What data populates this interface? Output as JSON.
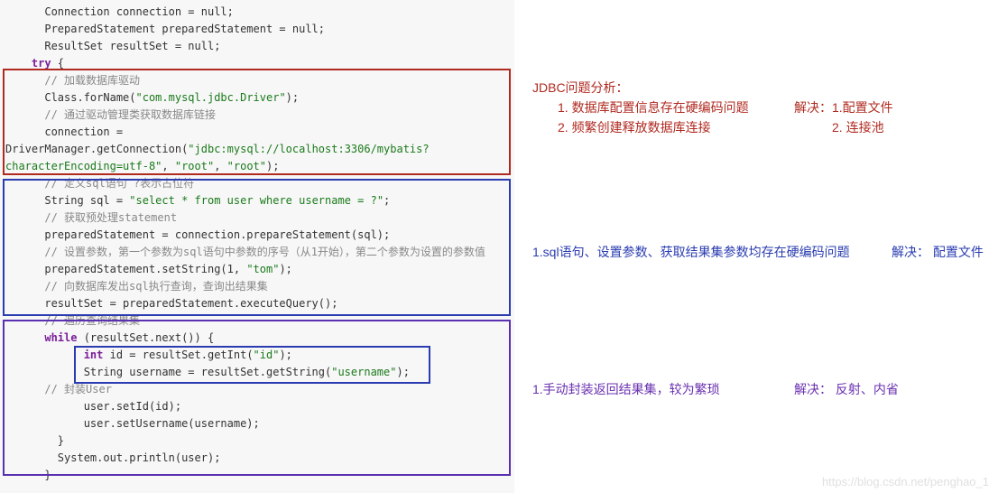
{
  "code": {
    "l1": "      Connection connection = null;",
    "l2": "      PreparedStatement preparedStatement = null;",
    "l3": "      ResultSet resultSet = null;",
    "l4_try": "    try",
    "l4_brace": " {",
    "l5": "      // 加载数据库驱动",
    "l6a": "      Class.forName(",
    "l6b": "\"com.mysql.jdbc.Driver\"",
    "l6c": ");",
    "l7": "      // 通过驱动管理类获取数据库链接",
    "l8": "      connection =",
    "l9a": "DriverManager.getConnection(",
    "l9b": "\"jdbc:mysql://localhost:3306/mybatis?",
    "l10a": "characterEncoding=utf-8\"",
    "l10b": ", ",
    "l10c": "\"root\"",
    "l10d": ", ",
    "l10e": "\"root\"",
    "l10f": ");",
    "l11": "      // 定义sql语句 ?表示占位符",
    "l12a": "      String sql = ",
    "l12b": "\"select * from user where username = ?\"",
    "l12c": ";",
    "l13": "      // 获取预处理statement",
    "l14": "      preparedStatement = connection.prepareStatement(sql);",
    "l15": "      // 设置参数，第一个参数为sql语句中参数的序号（从1开始），第二个参数为设置的参数值",
    "l16a": "      preparedStatement.setString(1, ",
    "l16b": "\"tom\"",
    "l16c": ");",
    "l17": "      // 向数据库发出sql执行查询，查询出结果集",
    "l18": "      resultSet = preparedStatement.executeQuery();",
    "l19": "      // 遍历查询结果集",
    "l20_while": "      while",
    "l20_rest": " (resultSet.next()) {",
    "l21_int": "            int",
    "l21_rest_a": " id = resultSet.getInt(",
    "l21_rest_b": "\"id\"",
    "l21_rest_c": ");",
    "l22a": "            String username = resultSet.getString(",
    "l22b": "\"username\"",
    "l22c": ");",
    "l23": "      // 封装User",
    "l24": "            user.setId(id);",
    "l25": "            user.setUsername(username);",
    "l26": "        }",
    "l27": "        System.out.println(user);",
    "l28": "      }"
  },
  "notes": {
    "red_title": "JDBC问题分析：",
    "red_1": "1. 数据库配置信息存在硬编码问题",
    "red_2": "2. 频繁创建释放数据库连接",
    "red_sol_1": "解决：1.配置文件",
    "red_sol_2": "2. 连接池",
    "blue_1": "1.sql语句、设置参数、获取结果集参数均存在硬编码问题",
    "blue_sol": "解决： 配置文件",
    "purple_1": "1.手动封装返回结果集，较为繁琐",
    "purple_sol": "解决： 反射、内省"
  },
  "watermark": "https://blog.csdn.net/penghao_1"
}
